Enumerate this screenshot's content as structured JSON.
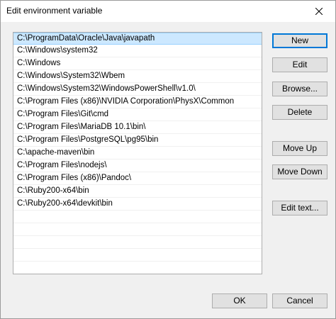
{
  "window": {
    "title": "Edit environment variable",
    "close_glyph": "close-icon"
  },
  "list": {
    "items": [
      "C:\\ProgramData\\Oracle\\Java\\javapath",
      "C:\\Windows\\system32",
      "C:\\Windows",
      "C:\\Windows\\System32\\Wbem",
      "C:\\Windows\\System32\\WindowsPowerShell\\v1.0\\",
      "C:\\Program Files (x86)\\NVIDIA Corporation\\PhysX\\Common",
      "C:\\Program Files\\Git\\cmd",
      "C:\\Program Files\\MariaDB 10.1\\bin\\",
      "C:\\Program Files\\PostgreSQL\\pg95\\bin",
      "C:\\apache-maven\\bin",
      "C:\\Program Files\\nodejs\\",
      "C:\\Program Files (x86)\\Pandoc\\",
      "C:\\Ruby200-x64\\bin",
      "C:\\Ruby200-x64\\devkit\\bin"
    ],
    "selected_index": 0,
    "empty_rows": 6
  },
  "buttons": {
    "new": "New",
    "edit": "Edit",
    "browse": "Browse...",
    "delete": "Delete",
    "move_up": "Move Up",
    "move_down": "Move Down",
    "edit_text": "Edit text...",
    "ok": "OK",
    "cancel": "Cancel"
  },
  "colors": {
    "selection": "#cce8ff",
    "selection_border": "#99d1ff",
    "accent": "#0078d7"
  }
}
